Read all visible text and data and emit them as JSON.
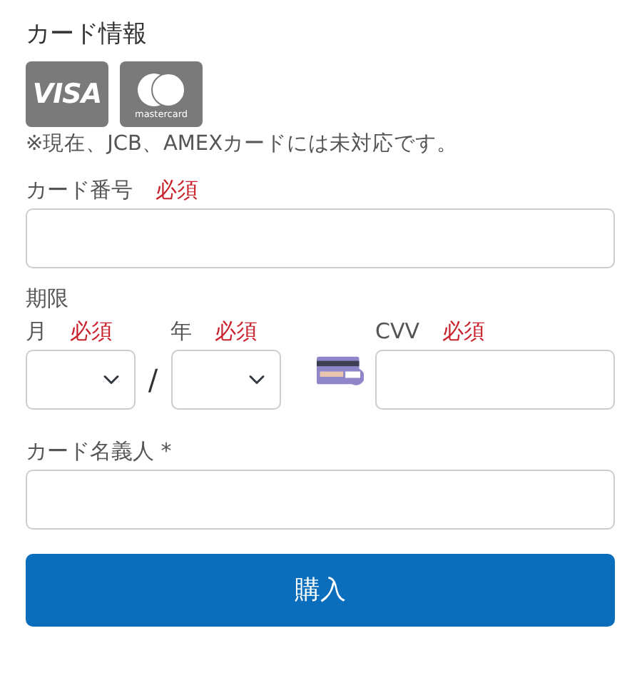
{
  "title": "カード情報",
  "card_brands": [
    {
      "kind": "visa",
      "label": "VISA"
    },
    {
      "kind": "mastercard",
      "label": "mastercard"
    }
  ],
  "note": "※現在、JCB、AMEXカードには未対応です。",
  "card_number": {
    "label": "カード番号",
    "required": "必須"
  },
  "expiry": {
    "label": "期限",
    "month": {
      "label": "月",
      "required": "必須"
    },
    "separator": "/",
    "year": {
      "label": "年",
      "required": "必須"
    }
  },
  "cvv": {
    "label": "CVV",
    "required": "必須"
  },
  "holder": {
    "label": "カード名義人 *"
  },
  "submit": "購入"
}
